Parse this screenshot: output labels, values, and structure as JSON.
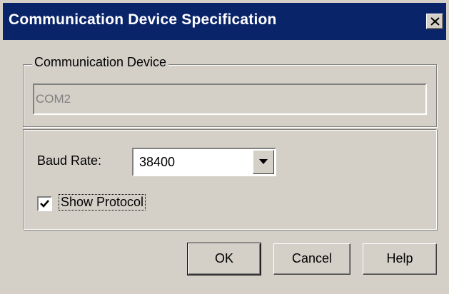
{
  "window": {
    "title": "Communication Device Specification",
    "title_bar_color": "#0a246a",
    "face_color": "#d4d0c8",
    "close_icon": "close-icon"
  },
  "device_group": {
    "legend": "Communication Device",
    "field_value": "COM2"
  },
  "settings": {
    "baud_label": "Baud Rate:",
    "baud_value": "38400",
    "dropdown_icon": "chevron-down-icon",
    "show_protocol_label": "Show Protocol",
    "show_protocol_checked": true
  },
  "buttons": {
    "ok": "OK",
    "cancel": "Cancel",
    "help": "Help"
  }
}
